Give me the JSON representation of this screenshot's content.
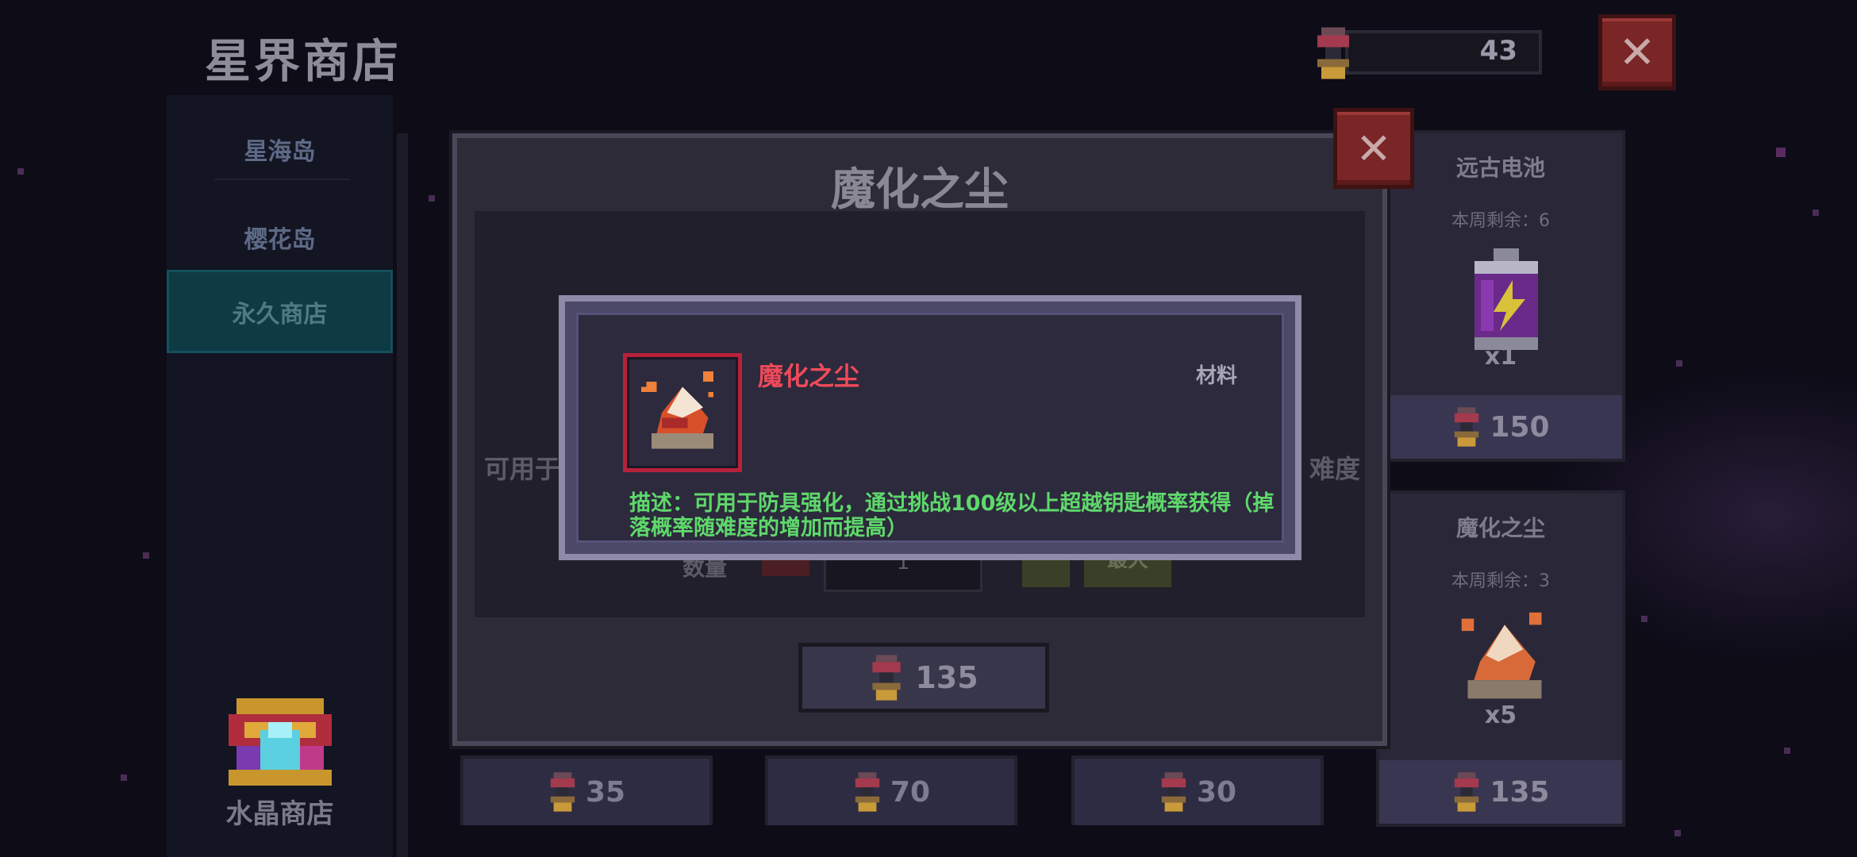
{
  "header": {
    "title": "星界商店",
    "currency_amount": "43"
  },
  "sidebar": {
    "items": [
      {
        "label": "星海岛"
      },
      {
        "label": "樱花岛"
      },
      {
        "label": "永久商店"
      }
    ],
    "active_index": 2,
    "crystal_shop_label": "水晶商店"
  },
  "shop_cards": {
    "ancient_battery": {
      "name": "远古电池",
      "stock": "本周剩余：6",
      "quantity": "x1",
      "price": "150"
    },
    "magic_dust": {
      "name": "魔化之尘",
      "stock": "本周剩余：3",
      "quantity": "x5",
      "price": "135"
    },
    "bottom_prices": [
      "35",
      "70",
      "30"
    ]
  },
  "purchase_dialog": {
    "title": "魔化之尘",
    "left_partial_text": "可用于",
    "right_partial_text": "难度",
    "quantity_label": "数量",
    "max_label": "最大",
    "quantity_value": "1",
    "buy_price": "135"
  },
  "tooltip": {
    "item_name": "魔化之尘",
    "item_type": "材料",
    "description": "描述：可用于防具强化，通过挑战100级以上超越钥匙概率获得（掉落概率随难度的增加而提高）"
  },
  "colors": {
    "background": "#0d0c17",
    "sidebar_active": "#0e3a44",
    "close_button": "#7a2626",
    "item_name": "#ef4a5a",
    "description": "#5fd86b"
  }
}
